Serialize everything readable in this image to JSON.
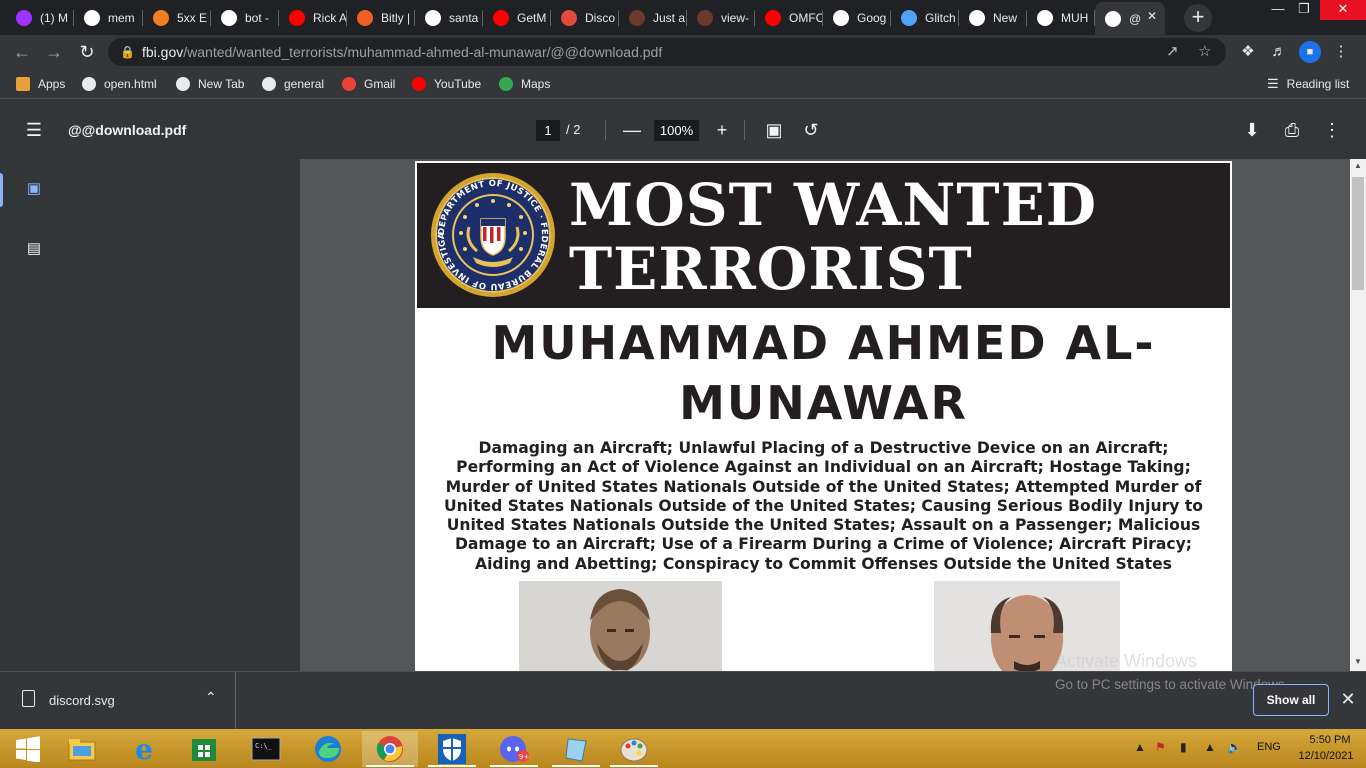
{
  "tabs": [
    {
      "title": "(1) M",
      "icon": "messenger-icon",
      "color": "#a033ff"
    },
    {
      "title": "mem",
      "icon": "google-icon",
      "color": "#ffffff"
    },
    {
      "title": "5xx E",
      "icon": "cloudflare-icon",
      "color": "#f38020"
    },
    {
      "title": "bot -",
      "icon": "replit-icon",
      "color": "#ffffff"
    },
    {
      "title": "Rick A",
      "icon": "youtube-icon",
      "color": "#ff0000"
    },
    {
      "title": "Bitly |",
      "icon": "bitly-icon",
      "color": "#ee6123"
    },
    {
      "title": "santa",
      "icon": "google-icon",
      "color": "#ffffff"
    },
    {
      "title": "GetM",
      "icon": "youtube-icon",
      "color": "#ff0000"
    },
    {
      "title": "Disco",
      "icon": "document-icon",
      "color": "#e24a3b"
    },
    {
      "title": "Just a",
      "icon": "avatar-icon",
      "color": "#6b3a2a"
    },
    {
      "title": "view-",
      "icon": "avatar-icon",
      "color": "#6b3a2a"
    },
    {
      "title": "OMFC",
      "icon": "youtube-icon",
      "color": "#ff0000"
    },
    {
      "title": "Goog",
      "icon": "google-icon",
      "color": "#ffffff"
    },
    {
      "title": "Glitch",
      "icon": "glitch-icon",
      "color": "#4fa3f7"
    },
    {
      "title": "New",
      "icon": "globe-icon",
      "color": "#ffffff"
    },
    {
      "title": "MUH",
      "icon": "globe-icon",
      "color": "#ffffff"
    },
    {
      "title": "@",
      "icon": "globe-icon",
      "color": "#ffffff"
    }
  ],
  "address": {
    "host": "fbi.gov",
    "path": "/wanted/wanted_terrorists/muhammad-ahmed-al-munawar/@@download.pdf"
  },
  "bookmarks": [
    {
      "label": "Apps",
      "icon": "apps-grid-icon"
    },
    {
      "label": "open.html",
      "icon": "globe-icon"
    },
    {
      "label": "New Tab",
      "icon": "globe-icon"
    },
    {
      "label": "general",
      "icon": "globe-icon"
    },
    {
      "label": "Gmail",
      "icon": "gmail-icon"
    },
    {
      "label": "YouTube",
      "icon": "youtube-icon"
    },
    {
      "label": "Maps",
      "icon": "maps-icon"
    }
  ],
  "reading_list": "Reading list",
  "pdf": {
    "filename": "@@download.pdf",
    "current_page": "1",
    "total_pages": "/  2",
    "zoom": "100%"
  },
  "poster": {
    "title_line1": "MOST WANTED",
    "title_line2": "TERRORIST",
    "name_line1": "MUHAMMAD AHMED AL-",
    "name_line2": "MUNAWAR",
    "charges": [
      "Damaging an Aircraft; Unlawful Placing of a Destructive Device on an Aircraft;",
      "Performing an Act of Violence Against an Individual on an Aircraft; Hostage Taking;",
      "Murder of United States Nationals Outside of the United States; Attempted Murder of",
      "United States Nationals Outside of the United States; Causing Serious Bodily Injury to",
      "United States Nationals Outside the United States; Assault on a Passenger; Malicious",
      "Damage to an Aircraft; Use of a Firearm During a Crime of Violence; Aircraft Piracy;",
      "Aiding and Abetting; Conspiracy to Commit Offenses Outside the United States"
    ],
    "seal_text": "DEPARTMENT OF JUSTICE · FEDERAL BUREAU OF INVESTIGATION"
  },
  "download": {
    "filename": "discord.svg",
    "show_all": "Show all"
  },
  "watermark": {
    "line1": "Activate Windows",
    "line2": "Go to PC settings to activate Windows."
  },
  "taskbar": {
    "apps": [
      "start-icon",
      "file-explorer-icon",
      "internet-explorer-icon",
      "store-icon",
      "cmd-icon",
      "edge-icon",
      "chrome-icon",
      "defender-icon",
      "discord-icon",
      "notepad-icon",
      "paint-icon"
    ],
    "lang": "ENG",
    "time": "5:50 PM",
    "date": "12/10/2021"
  }
}
